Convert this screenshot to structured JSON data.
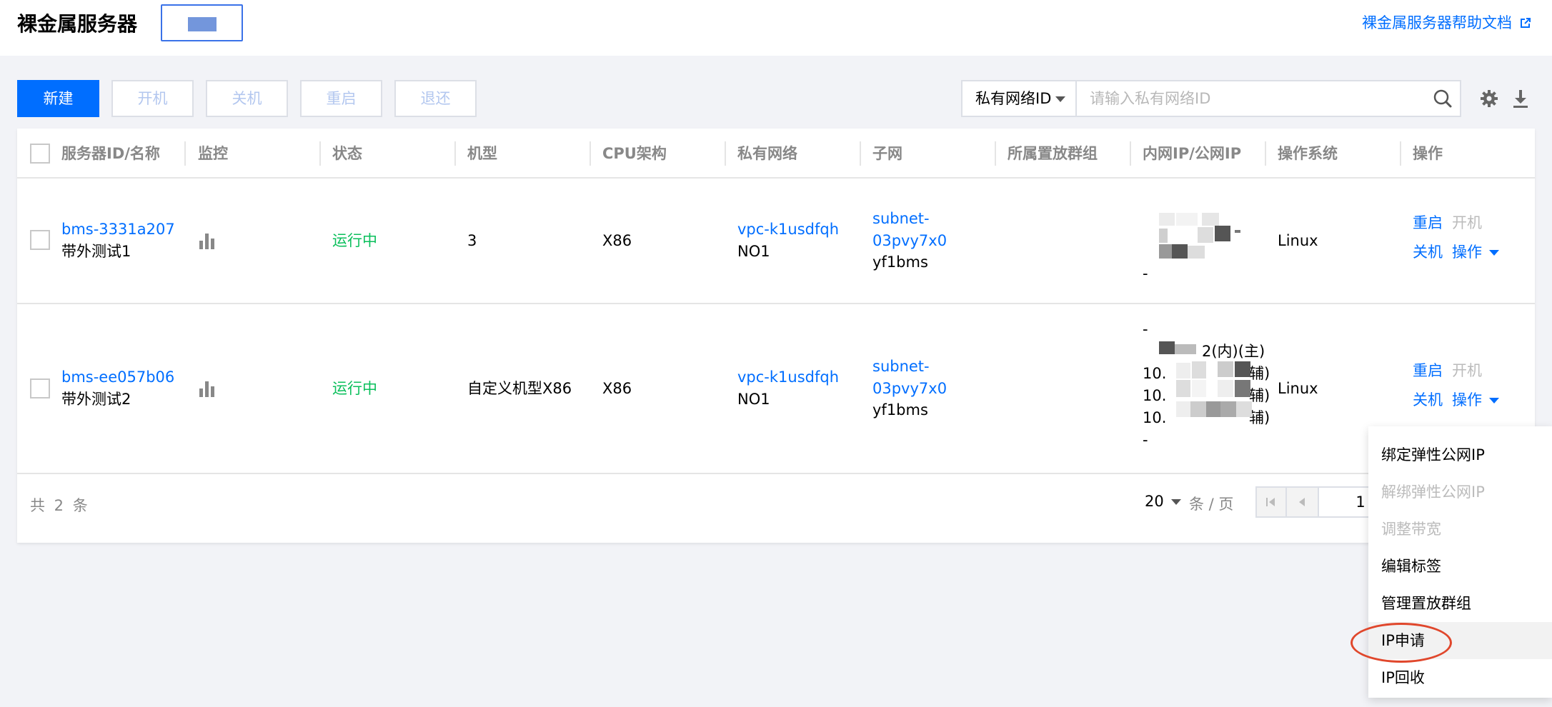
{
  "header": {
    "title": "裸金属服务器",
    "help_link": "裸金属服务器帮助文档"
  },
  "toolbar": {
    "new_label": "新建",
    "power_on_label": "开机",
    "power_off_label": "关机",
    "restart_label": "重启",
    "return_label": "退还",
    "search_field": "私有网络ID",
    "search_placeholder": "请输入私有网络ID"
  },
  "table": {
    "columns": [
      "服务器ID/名称",
      "监控",
      "状态",
      "机型",
      "CPU架构",
      "私有网络",
      "子网",
      "所属置放群组",
      "内网IP/公网IP",
      "操作系统",
      "操作"
    ],
    "rows": [
      {
        "id": "bms-3331a207",
        "name": "带外测试1",
        "status": "运行中",
        "model": "3",
        "cpu": "X86",
        "vpc_id": "vpc-k1usdfqh",
        "vpc_name": "NO1",
        "subnet_line1": "subnet-",
        "subnet_line2": "03pvy7x0",
        "subnet_name": "yf1bms",
        "ip_last": "-",
        "os": "Linux",
        "op_restart": "重启",
        "op_power_on": "开机",
        "op_power_off": "关机",
        "op_more": "操作"
      },
      {
        "id": "bms-ee057b06",
        "name": "带外测试2",
        "status": "运行中",
        "model": "自定义机型X86",
        "cpu": "X86",
        "vpc_id": "vpc-k1usdfqh",
        "vpc_name": "NO1",
        "subnet_line1": "subnet-",
        "subnet_line2": "03pvy7x0",
        "subnet_name": "yf1bms",
        "ip_lines": [
          "-",
          "2(内)(主)",
          "10.",
          "10.",
          "10.",
          "-"
        ],
        "ip_suffix": [
          "辅)",
          "辅)",
          "辅)"
        ],
        "os": "Linux",
        "op_restart": "重启",
        "op_power_on": "开机",
        "op_power_off": "关机",
        "op_more": "操作"
      }
    ]
  },
  "footer": {
    "total": "共 2 条",
    "page_size": "20",
    "page_size_unit": "条 / 页",
    "current_page": "1"
  },
  "menu": {
    "items": [
      {
        "label": "绑定弹性公网IP",
        "enabled": true
      },
      {
        "label": "解绑弹性公网IP",
        "enabled": false
      },
      {
        "label": "调整带宽",
        "enabled": false
      },
      {
        "label": "编辑标签",
        "enabled": true
      },
      {
        "label": "管理置放群组",
        "enabled": true
      },
      {
        "label": "IP申请",
        "enabled": true
      },
      {
        "label": "IP回收",
        "enabled": true
      }
    ],
    "highlighted": "IP申请"
  },
  "colors": {
    "primary": "#006eff",
    "running": "#0abf5b",
    "highlight_ring": "#e0472c"
  }
}
